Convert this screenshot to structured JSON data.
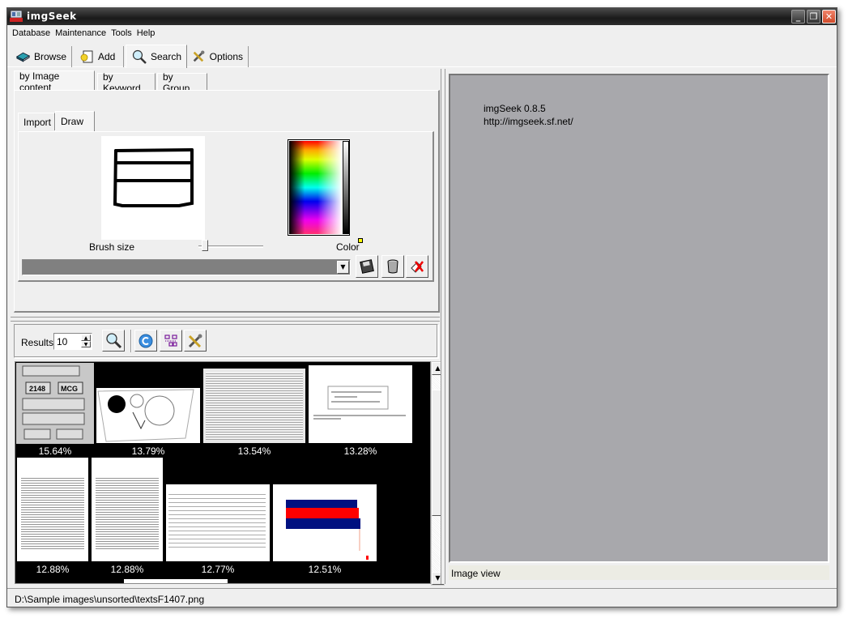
{
  "window": {
    "title": "imgSeek",
    "controls": [
      "minimize",
      "restore",
      "close"
    ]
  },
  "menubar": {
    "items": [
      "Database",
      "Maintenance",
      "Tools",
      "Help"
    ]
  },
  "main_tabs": [
    {
      "label": "Browse",
      "icon": "book-icon"
    },
    {
      "label": "Add",
      "icon": "add-image-icon"
    },
    {
      "label": "Search",
      "icon": "magnifier-icon",
      "active": true
    },
    {
      "label": "Options",
      "icon": "tools-icon"
    }
  ],
  "search_tabs": [
    {
      "label": "by Image content",
      "active": true
    },
    {
      "label": "by Keyword"
    },
    {
      "label": "by Group"
    }
  ],
  "source_tabs": [
    {
      "label": "Import"
    },
    {
      "label": "Draw",
      "active": true
    }
  ],
  "draw": {
    "brush_size_label": "Brush size",
    "brush_size_value": 0.1,
    "color_label": "Color",
    "selected_color": "#ffff00",
    "combo_value": "",
    "buttons": [
      "save-sketch",
      "clear-sketch",
      "delete-sketch"
    ]
  },
  "results_bar": {
    "label": "Results",
    "count": "10",
    "buttons": [
      "query",
      "refresh",
      "layout",
      "options"
    ]
  },
  "results": [
    {
      "score": "15.64%",
      "kind": "form"
    },
    {
      "score": "13.79%",
      "kind": "sketch"
    },
    {
      "score": "13.54%",
      "kind": "screenshot"
    },
    {
      "score": "13.28%",
      "kind": "text-doc"
    },
    {
      "score": "12.88%",
      "kind": "table-doc"
    },
    {
      "score": "12.88%",
      "kind": "table-doc"
    },
    {
      "score": "12.77%",
      "kind": "text-doc"
    },
    {
      "score": "12.51%",
      "kind": "flag-chart"
    }
  ],
  "image_view": {
    "line1": "imgSeek 0.8.5",
    "line2": "http://imgseek.sf.net/",
    "caption": "Image view"
  },
  "status": {
    "path": "D:\\Sample images\\unsorted\\textsF1407.png"
  },
  "colors": {
    "titlebar": "#1a1a1a",
    "window_bg": "#efefef",
    "image_view_bg": "#a8a8ac",
    "results_bg": "#000000",
    "close_button": "#d14a2a"
  }
}
